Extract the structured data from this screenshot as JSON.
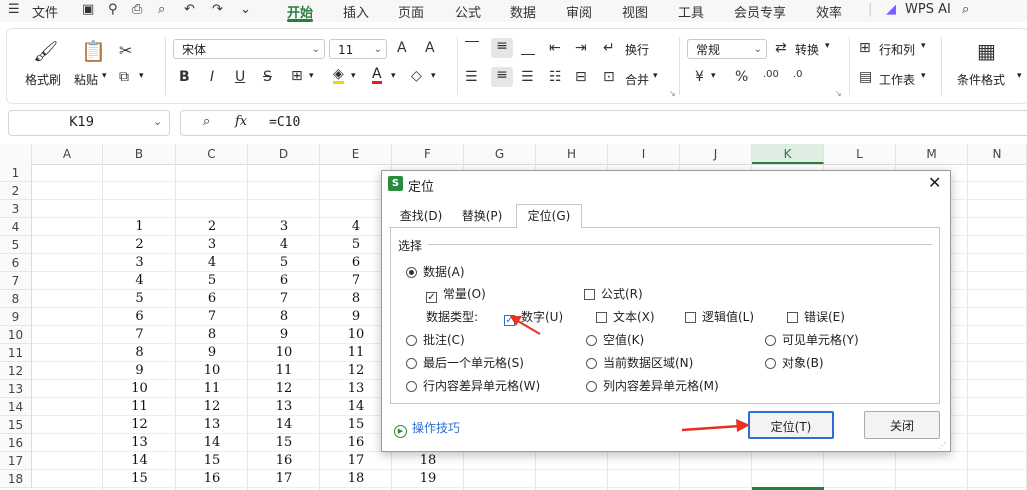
{
  "menubar": {
    "file": "文件",
    "tabs": [
      "开始",
      "插入",
      "页面",
      "公式",
      "数据",
      "审阅",
      "视图",
      "工具",
      "会员专享",
      "效率"
    ],
    "ai": "WPS AI"
  },
  "ribbon": {
    "format_painter": "格式刷",
    "paste": "粘贴",
    "font_name": "宋体",
    "font_size": "11",
    "wrap": "换行",
    "merge": "合并",
    "number_format": "常规",
    "convert": "转换",
    "rows_cols": "行和列",
    "worksheet": "工作表",
    "conditional_format": "条件格式",
    "bold": "B",
    "italic": "I",
    "underline": "U",
    "strike": "S",
    "font_color": "A",
    "currency": "¥",
    "percent": "%",
    "grow_font": "A",
    "shrink_font": "A"
  },
  "formula_bar": {
    "cell_ref": "K19",
    "fx": "fx",
    "formula": "=C10"
  },
  "grid": {
    "columns": [
      "A",
      "B",
      "C",
      "D",
      "E",
      "F",
      "G",
      "H",
      "I",
      "J",
      "K",
      "L",
      "M",
      "N"
    ],
    "rows": [
      "1",
      "2",
      "3",
      "4",
      "5",
      "6",
      "7",
      "8",
      "9",
      "10",
      "11",
      "12",
      "13",
      "14",
      "15",
      "16",
      "17",
      "18"
    ],
    "selected_column": "K",
    "data": [
      [
        "1",
        "2",
        "3",
        "4"
      ],
      [
        "2",
        "3",
        "4",
        "5"
      ],
      [
        "3",
        "4",
        "5",
        "6"
      ],
      [
        "4",
        "5",
        "6",
        "7"
      ],
      [
        "5",
        "6",
        "7",
        "8"
      ],
      [
        "6",
        "7",
        "8",
        "9"
      ],
      [
        "7",
        "8",
        "9",
        "10"
      ],
      [
        "8",
        "9",
        "10",
        "11"
      ],
      [
        "9",
        "10",
        "11",
        "12"
      ],
      [
        "10",
        "11",
        "12",
        "13"
      ],
      [
        "11",
        "12",
        "13",
        "14"
      ],
      [
        "12",
        "13",
        "14",
        "15"
      ],
      [
        "13",
        "14",
        "15",
        "16"
      ],
      [
        "14",
        "15",
        "16",
        "17",
        "18"
      ],
      [
        "15",
        "16",
        "17",
        "18",
        "19"
      ]
    ]
  },
  "dialog": {
    "title": "定位",
    "tabs": [
      "查找(D)",
      "替换(P)",
      "定位(G)"
    ],
    "section": "选择",
    "data_option": "数据(A)",
    "constant": "常量(O)",
    "formula": "公式(R)",
    "data_type_label": "数据类型:",
    "number": "数字(U)",
    "text": "文本(X)",
    "logical": "逻辑值(L)",
    "error": "错误(E)",
    "comment": "批注(C)",
    "blank": "空值(K)",
    "visible": "可见单元格(Y)",
    "last_cell": "最后一个单元格(S)",
    "current_region": "当前数据区域(N)",
    "objects": "对象(B)",
    "row_diff": "行内容差异单元格(W)",
    "col_diff": "列内容差异单元格(M)",
    "tips": "操作技巧",
    "ok": "定位(T)",
    "close": "关闭"
  },
  "colors": {
    "accent": "#2a7d3c",
    "arrow": "#e53222",
    "primary_border": "#2b6fd6"
  }
}
